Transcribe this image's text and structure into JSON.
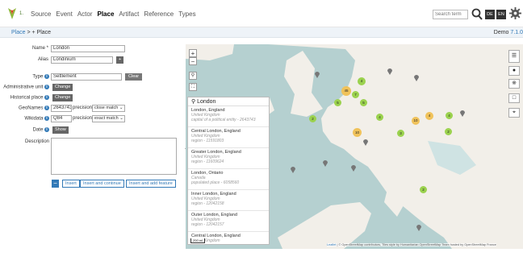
{
  "app": {
    "logo_text": "1.",
    "nav": [
      "Source",
      "Event",
      "Actor",
      "Place",
      "Artifact",
      "Reference",
      "Types"
    ],
    "search_placeholder": "Search term",
    "lang": [
      "DE",
      "EN"
    ],
    "version_label": "Demo",
    "version_number": "7.1.0"
  },
  "breadcrumb": {
    "link": "Place",
    "sep": ">",
    "current": "+ Place"
  },
  "form": {
    "name_label": "Name *",
    "name_value": "London",
    "alias_label": "Alias",
    "alias_value": "Londinium",
    "alias_add": "+",
    "type_label": "Type",
    "type_value": "Settlement",
    "type_clear": "Clear",
    "admin_label": "Administrative unit",
    "admin_btn": "Change",
    "historical_label": "Historical place",
    "historical_btn": "Change",
    "geonames_label": "GeoNames",
    "geonames_value": "2643743",
    "geonames_precision_label": "precision",
    "geonames_precision": "close match",
    "wikidata_label": "Wikidata",
    "wikidata_value": "Q84",
    "wikidata_precision_label": "precision",
    "wikidata_precision": "exact match",
    "date_label": "Date",
    "date_btn": "Show",
    "description_label": "Description",
    "insert": "Insert",
    "insert_continue": "Insert and continue",
    "insert_feature": "Insert and add feature",
    "info_glyph": "i"
  },
  "map": {
    "zoom_in": "+",
    "zoom_out": "−",
    "search_query": "London",
    "results": [
      {
        "title": "London, England",
        "sub1": "United Kingdom",
        "sub2": "capital of a political entity - 2643743"
      },
      {
        "title": "Central London, England",
        "sub1": "United Kingdom",
        "sub2": "region - 11591803"
      },
      {
        "title": "Greater London, England",
        "sub1": "United Kingdom",
        "sub2": "region - 11609624"
      },
      {
        "title": "London, Ontario",
        "sub1": "Canada",
        "sub2": "populated place - 6058560"
      },
      {
        "title": "Inner London, England",
        "sub1": "United Kingdom",
        "sub2": "region - 12042158"
      },
      {
        "title": "Outer London, England",
        "sub1": "United Kingdom",
        "sub2": "region - 12042157"
      },
      {
        "title": "Central London, England",
        "sub1": "United Kingdom",
        "sub2": ""
      }
    ],
    "clusters": [
      "4",
      "45",
      "7",
      "5",
      "5",
      "2",
      "4",
      "10",
      "3",
      "2",
      "10",
      "4",
      "4",
      "2"
    ],
    "scale": "200 mi",
    "attribution_leaflet": "Leaflet",
    "attribution_text": "| © OpenStreetMap contributors, Tiles style by Humanitarian OpenStreetMap Team hosted by OpenStreetMap France"
  },
  "colors": {
    "accent": "#337ab7",
    "cluster_green": "#8cc63f",
    "cluster_orange": "#f0a830",
    "map_water": "#b5d0d0",
    "land": "#f2efe9"
  }
}
